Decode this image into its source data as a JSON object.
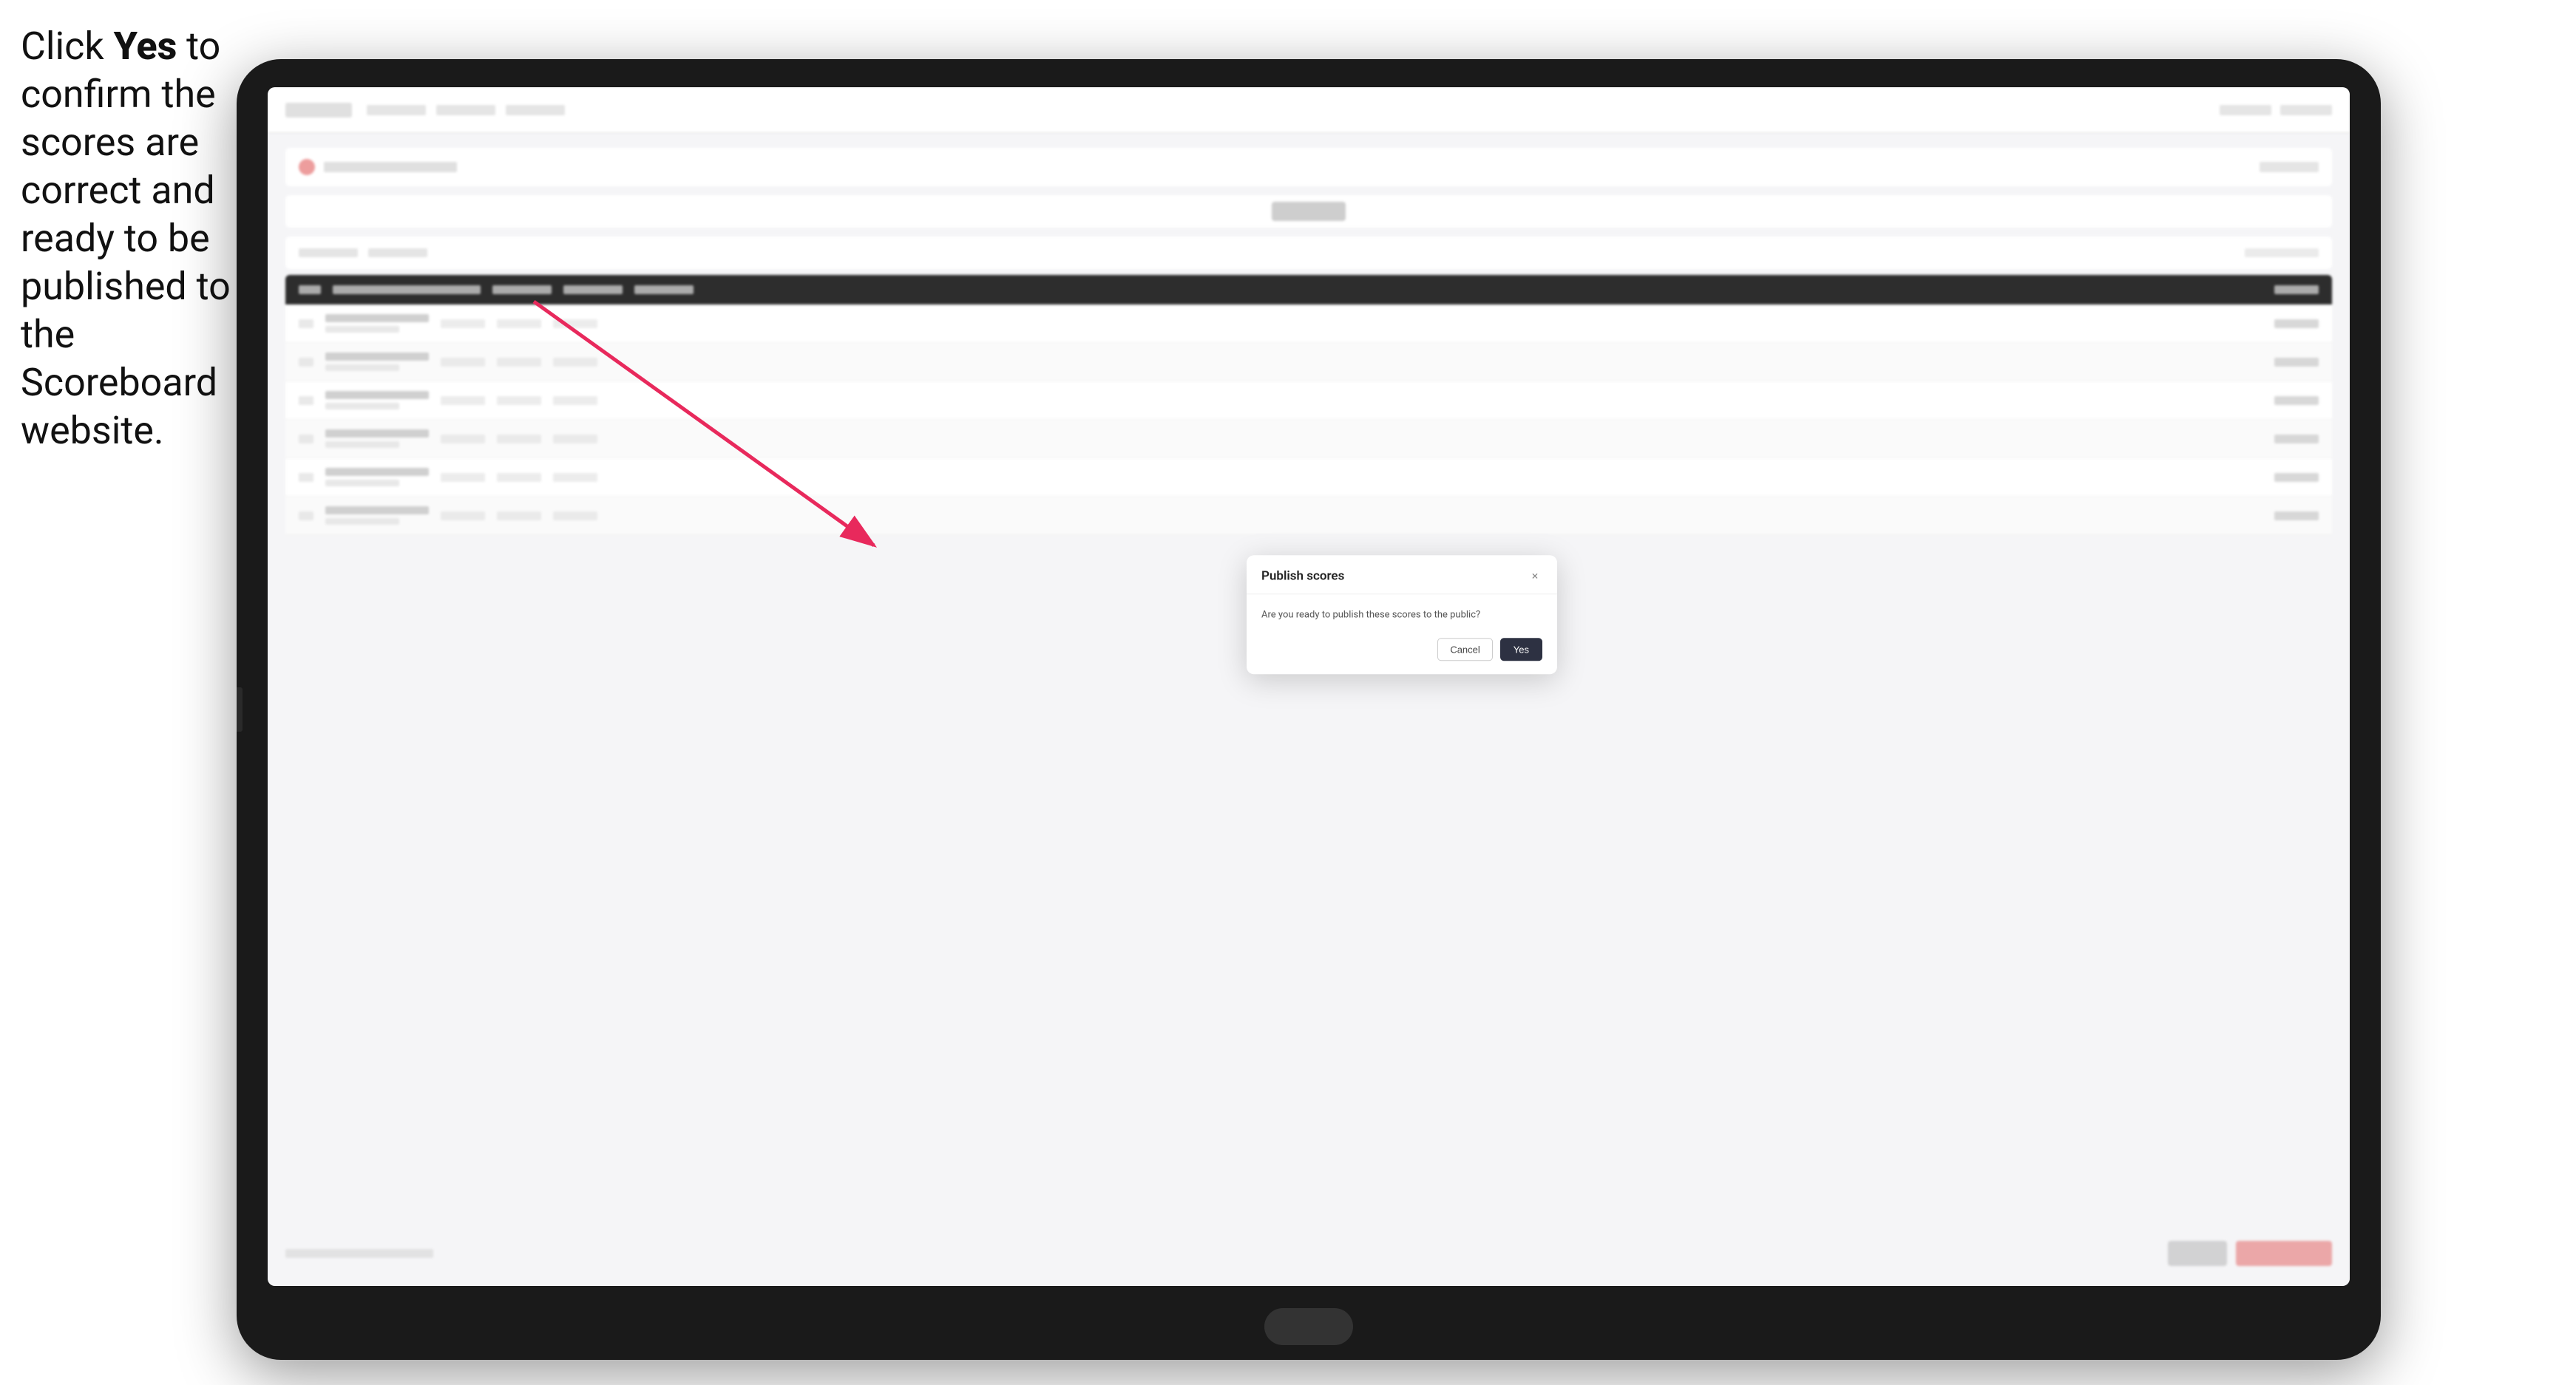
{
  "instruction": {
    "text_part1": "Click ",
    "bold_word": "Yes",
    "text_part2": " to confirm the scores are correct and ready to be published to the Scoreboard website."
  },
  "modal": {
    "title": "Publish scores",
    "message": "Are you ready to publish these scores to the public?",
    "cancel_label": "Cancel",
    "yes_label": "Yes",
    "close_icon": "×"
  },
  "colors": {
    "modal_bg": "#ffffff",
    "yes_btn_bg": "#2d3142",
    "cancel_btn_border": "#cccccc",
    "arrow_color": "#e8295c"
  }
}
